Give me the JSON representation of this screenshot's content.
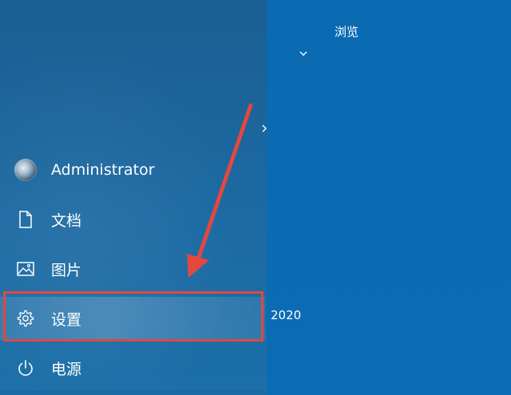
{
  "start_menu": {
    "items": [
      {
        "label": "Administrator",
        "icon": "user-avatar-icon"
      },
      {
        "label": "文档",
        "icon": "document-icon"
      },
      {
        "label": "图片",
        "icon": "picture-icon"
      },
      {
        "label": "设置",
        "icon": "gear-icon"
      },
      {
        "label": "电源",
        "icon": "power-icon"
      }
    ]
  },
  "tiles": {
    "browse_label": "浏览",
    "year_label": "2020"
  },
  "annotation": {
    "highlight_color": "#e2483e",
    "arrow_color": "#e2483e"
  },
  "colors": {
    "left_pane": "#1c6aa3",
    "right_pane": "#0b6cb3",
    "text": "#ffffff"
  }
}
